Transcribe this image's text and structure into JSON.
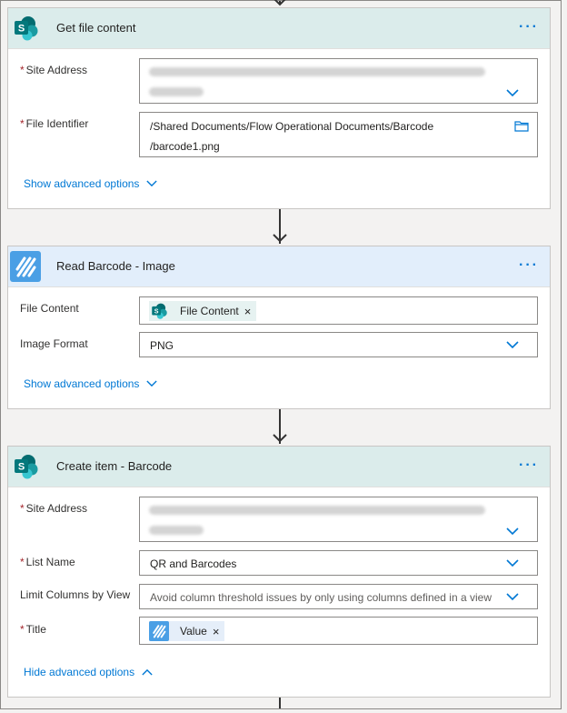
{
  "cards": {
    "get_file": {
      "title": "Get file content",
      "menu": "···",
      "site_address_label": "Site Address",
      "file_identifier_label": "File Identifier",
      "file_identifier_line1": "/Shared Documents/Flow Operational Documents/Barcode",
      "file_identifier_line2": "/barcode1.png",
      "advanced_label": "Show advanced options"
    },
    "read_barcode": {
      "title": "Read Barcode - Image",
      "menu": "···",
      "file_content_label": "File Content",
      "file_content_token": "File Content",
      "image_format_label": "Image Format",
      "image_format_value": "PNG",
      "advanced_label": "Show advanced options"
    },
    "create_item": {
      "title": "Create item - Barcode",
      "menu": "···",
      "site_address_label": "Site Address",
      "list_name_label": "List Name",
      "list_name_value": "QR and Barcodes",
      "limit_columns_label": "Limit Columns by View",
      "limit_columns_value": "Avoid column threshold issues by only using columns defined in a view",
      "title_label": "Title",
      "title_token": "Value",
      "advanced_label": "Hide advanced options"
    }
  },
  "token_remove": "×",
  "required_mark": "*",
  "icons": {
    "sharepoint": "sharepoint-icon",
    "encodian": "read-barcode-icon",
    "dropdown": "chevron-down-icon",
    "folder": "folder-icon"
  },
  "colors": {
    "link": "#0078d4",
    "sharepoint_header": "#dbeceb",
    "encodian_header": "#e2eefb",
    "required": "#a4262c"
  }
}
